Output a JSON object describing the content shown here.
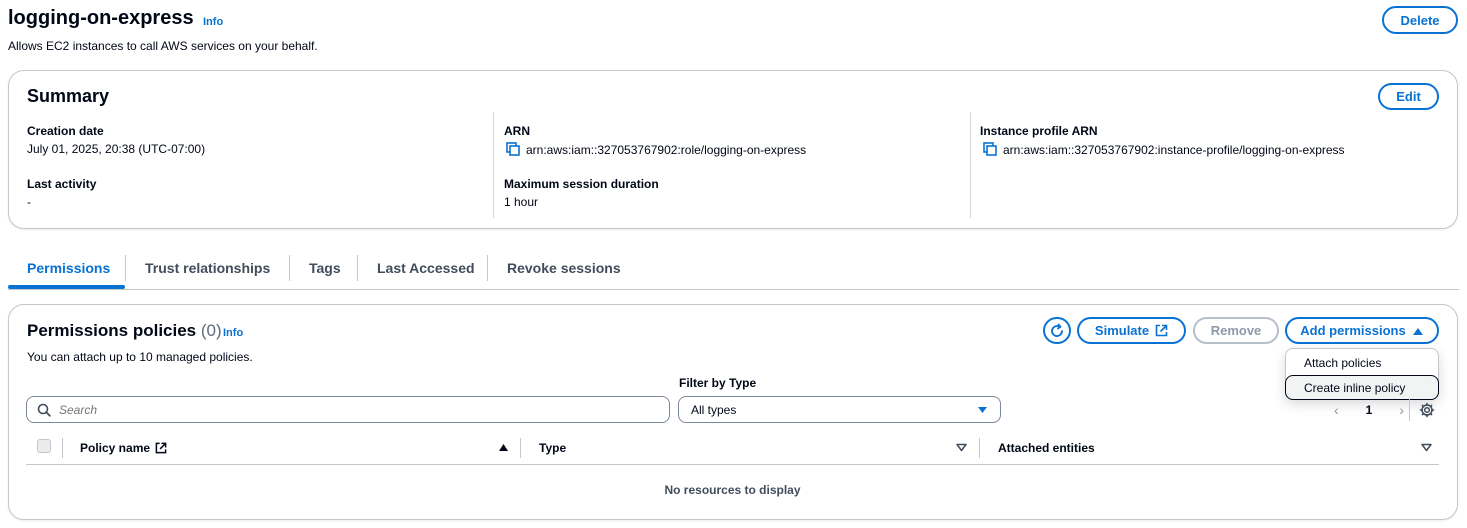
{
  "role": {
    "name": "logging-on-express",
    "info_link": "Info",
    "description": "Allows EC2 instances to call AWS services on your behalf.",
    "delete_label": "Delete"
  },
  "summary": {
    "title": "Summary",
    "edit_label": "Edit",
    "fields": {
      "creation_date_label": "Creation date",
      "creation_date_value": "July 01, 2025, 20:38 (UTC-07:00)",
      "last_activity_label": "Last activity",
      "last_activity_value": "-",
      "arn_label": "ARN",
      "arn_value": "arn:aws:iam::327053767902:role/logging-on-express",
      "max_session_label": "Maximum session duration",
      "max_session_value": "1 hour",
      "instance_profile_label": "Instance profile ARN",
      "instance_profile_value": "arn:aws:iam::327053767902:instance-profile/logging-on-express"
    }
  },
  "tabs": [
    {
      "label": "Permissions",
      "active": true
    },
    {
      "label": "Trust relationships",
      "active": false
    },
    {
      "label": "Tags",
      "active": false
    },
    {
      "label": "Last Accessed",
      "active": false
    },
    {
      "label": "Revoke sessions",
      "active": false
    }
  ],
  "permissions": {
    "title": "Permissions policies",
    "count": "(0)",
    "info_link": "Info",
    "description": "You can attach up to 10 managed policies.",
    "simulate_label": "Simulate",
    "remove_label": "Remove",
    "add_permissions_label": "Add permissions",
    "dropdown_items": [
      "Attach policies",
      "Create inline policy"
    ],
    "search_placeholder": "Search",
    "filter_label": "Filter by Type",
    "filter_value": "All types",
    "page_number": "1",
    "columns": [
      "Policy name",
      "Type",
      "Attached entities"
    ],
    "empty_text": "No resources to display"
  },
  "icons": {
    "refresh": "refresh-icon",
    "external": "external-link-icon",
    "copy": "copy-icon",
    "search": "search-icon",
    "settings": "gear-icon"
  },
  "colors": {
    "accent": "#0972d3",
    "text": "#000716",
    "border": "#c6c6cd",
    "disabled": "#8d99a8"
  }
}
